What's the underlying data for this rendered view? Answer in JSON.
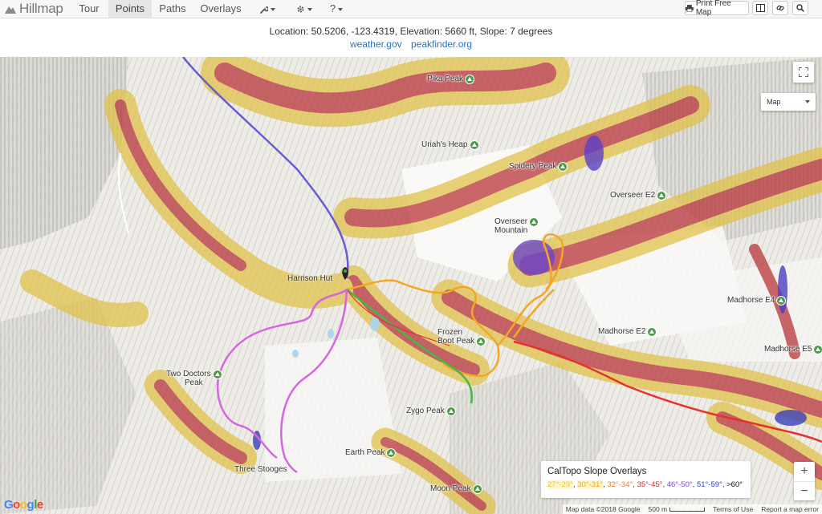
{
  "nav": {
    "brand": "Hillmap",
    "items": [
      {
        "label": "Tour",
        "active": false
      },
      {
        "label": "Points",
        "active": true
      },
      {
        "label": "Paths",
        "active": false
      },
      {
        "label": "Overlays",
        "active": false
      }
    ],
    "tools_icon": "wrench-icon",
    "settings_icon": "gear-icon",
    "help_label": "?",
    "print_label": "Print Free Map"
  },
  "info": {
    "line": "Location: 50.5206, -123.4319,    Elevation: 5660 ft,    Slope: 7 degrees",
    "links": [
      "weather.gov",
      "peakfinder.org"
    ]
  },
  "map": {
    "map_type": "Map",
    "hut": "Harrison Hut",
    "peaks": [
      {
        "name": "Pika Peak"
      },
      {
        "name": "Uriah's Heap"
      },
      {
        "name": "Spidery Peak"
      },
      {
        "name": "Overseer E2"
      },
      {
        "name": "Overseer",
        "line2": "Mountain"
      },
      {
        "name": "Madhorse E4"
      },
      {
        "name": "Madhorse E2"
      },
      {
        "name": "Madhorse E5"
      },
      {
        "name": "Frozen",
        "line2": "Boot Peak"
      },
      {
        "name": "Two Doctors",
        "line2": "Peak"
      },
      {
        "name": "Zygo Peak"
      },
      {
        "name": "Earth Peak"
      },
      {
        "name": "Three Stooges"
      },
      {
        "name": "Moon Peak"
      }
    ],
    "legend": {
      "title": "CalTopo Slope Overlays",
      "ranges": [
        "27°-29°",
        "30°-31°",
        "32°-34°",
        "35°-45°",
        "46°-50°",
        "51°-59°",
        ">60°"
      ],
      "colors": [
        "#e9c441",
        "#f0a030",
        "#f07a3a",
        "#d8262a",
        "#8c3fe0",
        "#2f3fd8",
        "#111111"
      ]
    },
    "zoom_in": "+",
    "zoom_out": "−",
    "google": "Google",
    "attribution": {
      "data": "Map data ©2018 Google",
      "scale": "500 m",
      "terms": "Terms of Use",
      "report": "Report a map error"
    },
    "route_colors": {
      "blue": "#6a5ad6",
      "orange": "#f5a623",
      "green": "#45b845",
      "magenta": "#d566e0",
      "red": "#e5322d"
    }
  }
}
